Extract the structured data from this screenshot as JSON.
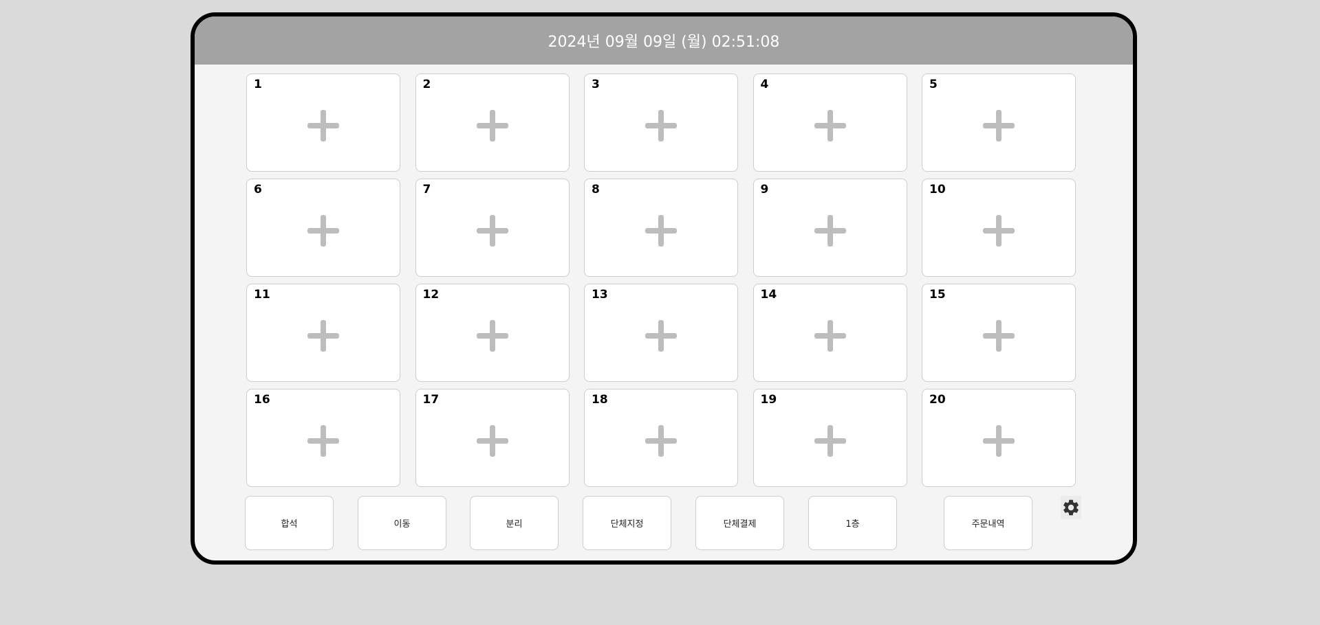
{
  "header": {
    "datetime": "2024년 09월 09일 (월) 02:51:08"
  },
  "tables": [
    {
      "number": "1"
    },
    {
      "number": "2"
    },
    {
      "number": "3"
    },
    {
      "number": "4"
    },
    {
      "number": "5"
    },
    {
      "number": "6"
    },
    {
      "number": "7"
    },
    {
      "number": "8"
    },
    {
      "number": "9"
    },
    {
      "number": "10"
    },
    {
      "number": "11"
    },
    {
      "number": "12"
    },
    {
      "number": "13"
    },
    {
      "number": "14"
    },
    {
      "number": "15"
    },
    {
      "number": "16"
    },
    {
      "number": "17"
    },
    {
      "number": "18"
    },
    {
      "number": "19"
    },
    {
      "number": "20"
    }
  ],
  "toolbar": {
    "merge_label": "합석",
    "move_label": "이동",
    "split_label": "분리",
    "group_assign_label": "단체지정",
    "group_pay_label": "단체결제",
    "floor_label": "1층",
    "order_history_label": "주문내역"
  },
  "icons": {
    "add": "plus-icon",
    "settings": "gear-icon"
  },
  "colors": {
    "header_bg": "#a3a3a3",
    "page_bg": "#dadada",
    "panel_bg": "#f4f4f4",
    "plus": "#bdbdbd",
    "gear": "#333333"
  }
}
